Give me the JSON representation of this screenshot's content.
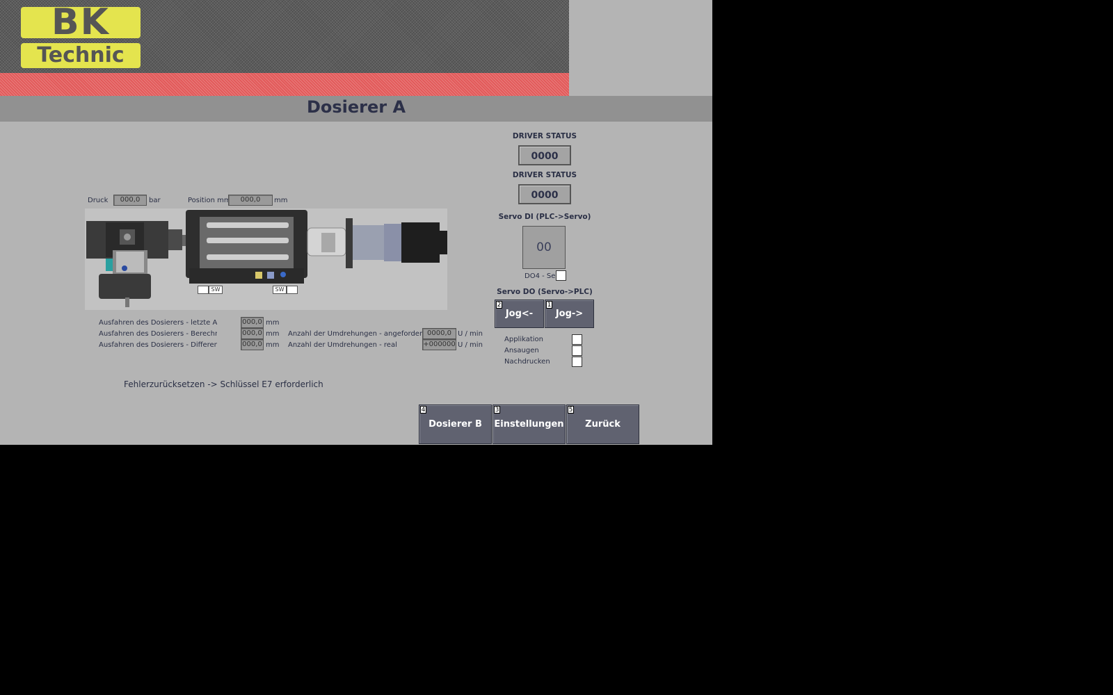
{
  "header": {
    "logo_line1": "BK",
    "logo_line2": "Technic",
    "title": "Dosierer A"
  },
  "process": {
    "druck_label": "Druck",
    "druck_value": "000,0",
    "druck_unit": "bar",
    "position_label": "Position mm",
    "position_value": "000,0",
    "position_unit": "mm"
  },
  "machine": {
    "sw_left": "SW",
    "sw_right": "SW"
  },
  "measurements": {
    "rows": [
      {
        "label": "Ausfahren des Dosierers - letzte Applika",
        "value": "000,0",
        "unit": "mm"
      },
      {
        "label": "Ausfahren des Dosierers - Berechnung",
        "value": "000,0",
        "unit": "mm"
      },
      {
        "label": "Ausfahren des Dosierers - Differenz",
        "value": "000,0",
        "unit": "mm"
      }
    ],
    "revolutions": [
      {
        "label": "Anzahl der Umdrehungen - angefordert",
        "value": "0000,0",
        "unit": "U / min"
      },
      {
        "label": "Anzahl der Umdrehungen - real",
        "value": "+000000",
        "unit": "U / min"
      }
    ]
  },
  "message": "Fehlerzurücksetzen -> Schlüssel E7 erforderlich",
  "driver": {
    "status1_label": "DRIVER STATUS",
    "status1_value": "0000",
    "status2_label": "DRIVER STATUS",
    "status2_value": "0000"
  },
  "servo_di": {
    "label": "Servo DI (PLC->Servo)",
    "value": "00",
    "do4_label": "DO4 - Se"
  },
  "servo_do": {
    "label": "Servo DO (Servo->PLC)",
    "jog_left": {
      "label": "Jog<-",
      "key": "2"
    },
    "jog_right": {
      "label": "Jog->",
      "key": "1"
    }
  },
  "modes": [
    {
      "label": "Applikation"
    },
    {
      "label": "Ansaugen"
    },
    {
      "label": "Nachdrucken"
    }
  ],
  "nav": [
    {
      "label": "Dosierer B",
      "key": "4"
    },
    {
      "label": "Einstellungen",
      "key": "3"
    },
    {
      "label": "Zurück",
      "key": "5"
    }
  ],
  "colors": {
    "background": "#b4b4b4",
    "title_bar": "#919191",
    "banner_stripe": "#e25a5a",
    "logo": "#e4e44e",
    "button": "#606270",
    "text": "#2c3048"
  }
}
